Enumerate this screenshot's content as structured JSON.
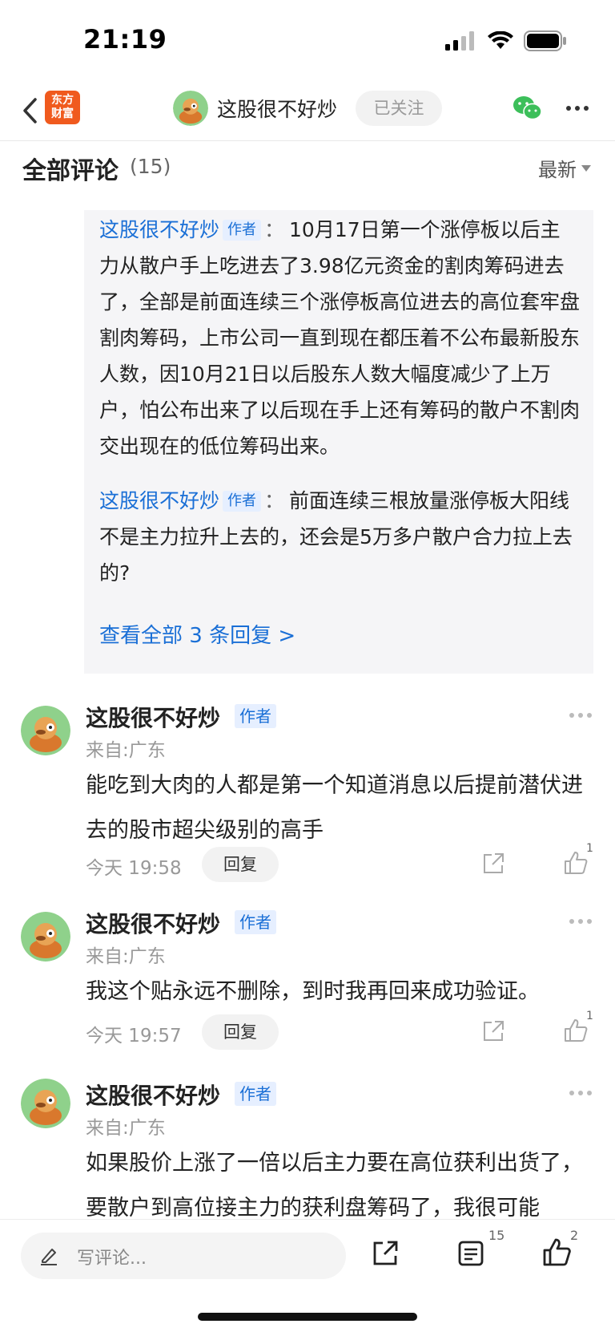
{
  "status_bar": {
    "time": "21:19"
  },
  "nav": {
    "logo_line1": "东方",
    "logo_line2": "财富",
    "username": "这股很不好炒",
    "follow_label": "已关注",
    "brand_color": "#f05a1e",
    "link_color": "#1a6fd6"
  },
  "section": {
    "title": "全部评论",
    "count": "(15)",
    "sort_label": "最新"
  },
  "reply_box": {
    "items": [
      {
        "user": "这股很不好炒",
        "tag": "作者",
        "colon": "：",
        "text": "10月17日第一个涨停板以后主力从散户手上吃进去了3.98亿元资金的割肉筹码进去了，全部是前面连续三个涨停板高位进去的高位套牢盘割肉筹码，上市公司一直到现在都压着不公布最新股东人数，因10月21日以后股东人数大幅度减少了上万户，怕公布出来了以后现在手上还有筹码的散户不割肉交出现在的低位筹码出来。"
      },
      {
        "user": "这股很不好炒",
        "tag": "作者",
        "colon": "：",
        "text": "前面连续三根放量涨停板大阳线不是主力拉升上去的，还会是5万多户散户合力拉上去的?"
      }
    ],
    "view_all": "查看全部 3 条回复 >"
  },
  "comments": [
    {
      "user": "这股很不好炒",
      "tag": "作者",
      "location": "来自:广东",
      "content": "能吃到大肉的人都是第一个知道消息以后提前潜伏进去的股市超尖级别的高手",
      "time": "今天 19:58",
      "reply_label": "回复",
      "likes": "1"
    },
    {
      "user": "这股很不好炒",
      "tag": "作者",
      "location": "来自:广东",
      "content": "我这个贴永远不删除，到时我再回来成功验证。",
      "time": "今天 19:57",
      "reply_label": "回复",
      "likes": "1"
    },
    {
      "user": "这股很不好炒",
      "tag": "作者",
      "location": "来自:广东",
      "content": "如果股价上涨了一倍以后主力要在高位获利出货了，要散户到高位接主力的获利盘筹码了，我很可能"
    }
  ],
  "bottom_bar": {
    "placeholder": "写评论...",
    "comments_count": "15",
    "likes_count": "2"
  }
}
